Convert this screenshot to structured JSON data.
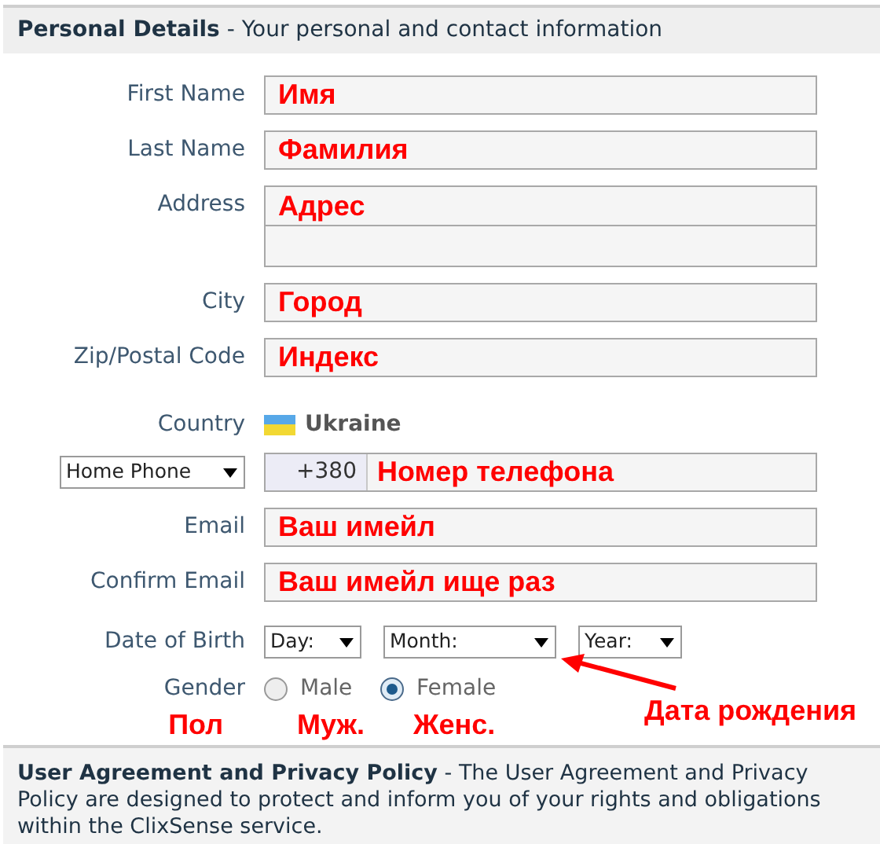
{
  "header": "**Personal Details** - Your personal and contact information",
  "fields": [
    {
      "kind": "text",
      "label": "First Name",
      "value": "Имя"
    },
    {
      "kind": "text",
      "label": "Last Name",
      "value": "Фамилия"
    },
    {
      "kind": "address",
      "label": "Address",
      "value": "Адрес"
    },
    {
      "kind": "text",
      "label": "City",
      "value": "Город"
    },
    {
      "kind": "text",
      "label": "Zip/Postal Code",
      "value": "Индекс"
    },
    {
      "kind": "country",
      "label": "Country",
      "value": "Ukraine"
    },
    {
      "kind": "phone",
      "type_select": "Home Phone",
      "prefix": "+380",
      "value": "Номер телефона"
    },
    {
      "kind": "text",
      "label": "Email",
      "value": "Ваш имейл"
    },
    {
      "kind": "text",
      "label": "Confirm Email",
      "value": "Ваш имейл ище раз"
    },
    {
      "kind": "date",
      "label": "Date of Birth",
      "selects": [
        "Day:",
        "Month:",
        "Year:"
      ],
      "note": "Дата рождения"
    },
    {
      "kind": "radio",
      "label": "Gender",
      "note": "Пол",
      "options": [
        {
          "label": "Male",
          "note": "Муж.",
          "selected": false
        },
        {
          "label": "Female",
          "note": "Женс.",
          "selected": true
        }
      ]
    }
  ],
  "footer": "**User Agreement and Privacy Policy** - The User Agreement and Privacy Policy are designed to protect and inform you of your rights and obligations within the ClixSense service."
}
